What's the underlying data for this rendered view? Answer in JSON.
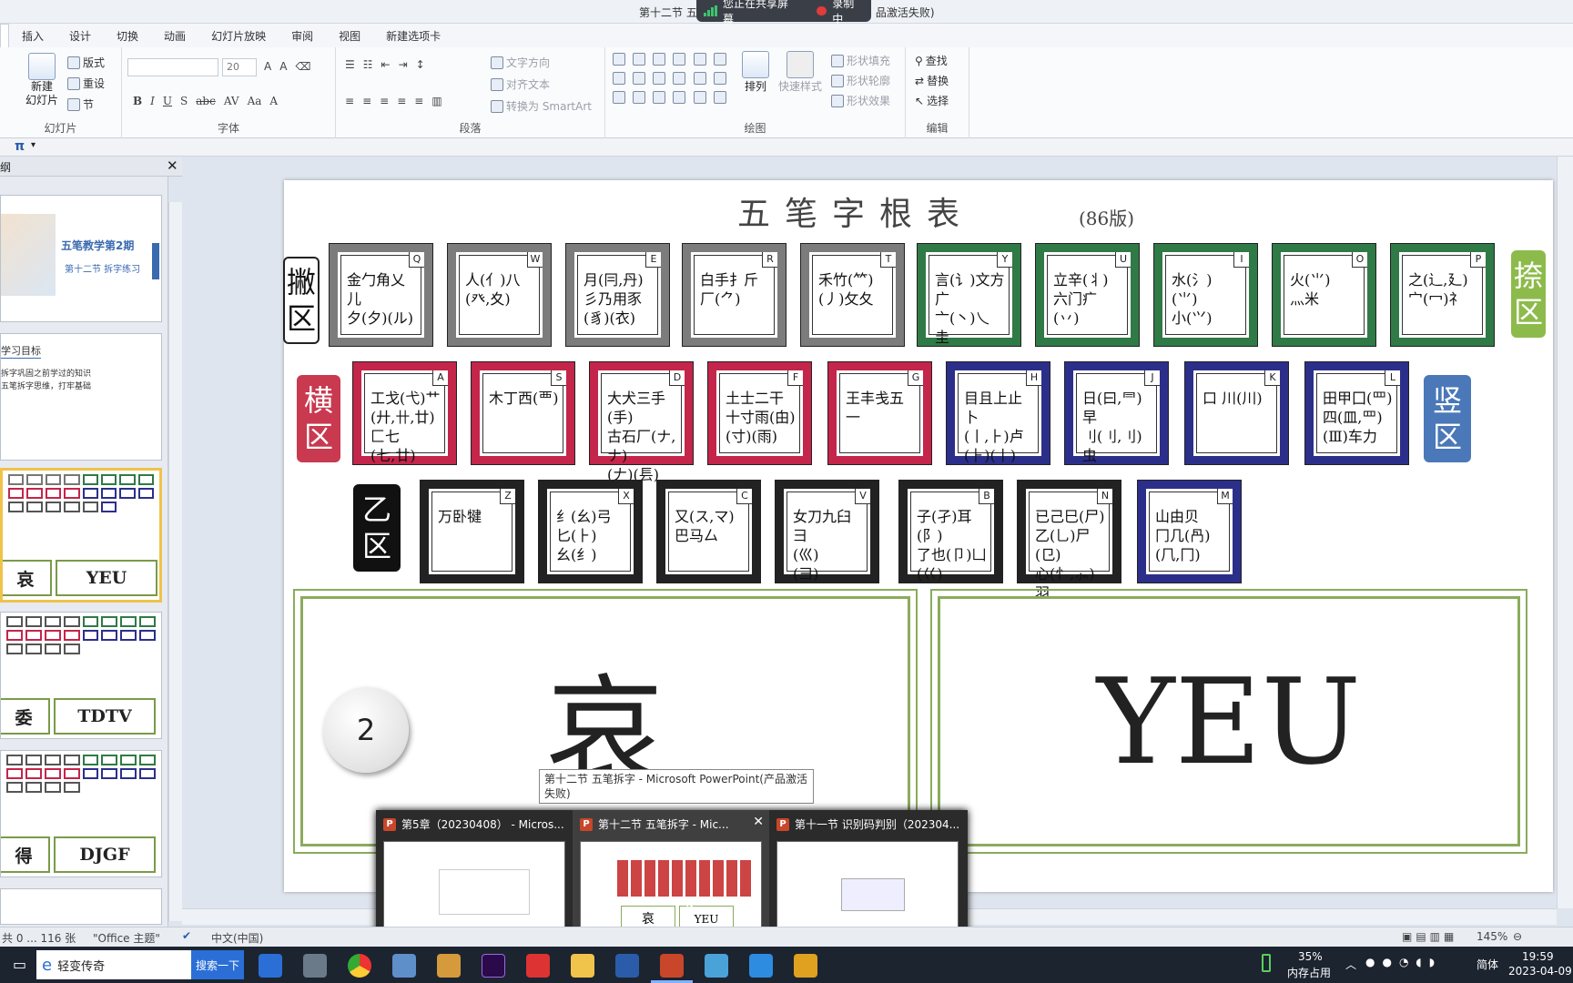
{
  "window": {
    "title_left": "第十二节 五",
    "title_right": "品激活失败)",
    "share_text": "您正在共享屏幕",
    "record_text": "录制中"
  },
  "tabs": [
    "插入",
    "设计",
    "切换",
    "动画",
    "幻灯片放映",
    "审阅",
    "视图",
    "新建选项卡"
  ],
  "ribbon": {
    "slides": {
      "new_slide": "新建\n幻灯片",
      "layout": "版式",
      "reset": "重设",
      "section": "节",
      "label": "幻灯片"
    },
    "font": {
      "size": "20",
      "label": "字体"
    },
    "paragraph": {
      "text_direction": "文字方向",
      "align_text": "对齐文本",
      "smartart": "转换为 SmartArt",
      "label": "段落"
    },
    "drawing": {
      "arrange": "排列",
      "quick_styles": "快速样式",
      "shape_fill": "形状填充",
      "shape_outline": "形状轮廓",
      "shape_effects": "形状效果",
      "label": "绘图"
    },
    "editing": {
      "find": "查找",
      "replace": "替换",
      "select": "选择",
      "label": "编辑"
    }
  },
  "qbar": {
    "pi": "π"
  },
  "panel": {
    "tab_label": "纲",
    "slide1": {
      "title": "五笔教学第2期",
      "subtitle": "第十二节 拆字练习"
    },
    "slide2": {
      "heading": "学习目标",
      "line1": "拆字巩固之前学过的知识",
      "line2": "五笔拆字思维，打牢基础"
    },
    "words": [
      {
        "han": "哀",
        "code": "YEU"
      },
      {
        "han": "委",
        "code": "TDTV"
      },
      {
        "han": "得",
        "code": "DJGF"
      }
    ]
  },
  "chart": {
    "title": "五笔字根表",
    "version": "(86版)",
    "zones": {
      "pie": "撇区",
      "na": "捺区",
      "heng": "横区",
      "shu": "竖区",
      "zhe": "乙区"
    },
    "colors": {
      "gray": "#7c7c7c",
      "green": "#2f7a46",
      "red": "#c4254a",
      "blue": "#2c2f8a",
      "black": "#222222",
      "zone_green": "#8dbb4b",
      "zone_red": "#c9394f",
      "zone_blue": "#4a78b8"
    },
    "row1": [
      {
        "key": "Q",
        "radicals": "金勹角乂儿\n夕(夕)(ル)"
      },
      {
        "key": "W",
        "radicals": "人(亻)八\n(癶,夊)"
      },
      {
        "key": "E",
        "radicals": "月(冃,丹)\n彡乃用豕\n(豸)(衣)"
      },
      {
        "key": "R",
        "radicals": "白手扌斤\n厂(⺈)"
      },
      {
        "key": "T",
        "radicals": "禾竹(⺮)\n(丿)攵夂"
      },
      {
        "key": "Y",
        "radicals": "言(讠)文方广\n亠(丶)乀\n圭"
      },
      {
        "key": "U",
        "radicals": "立辛(丬)\n六门疒\n(丷)"
      },
      {
        "key": "I",
        "radicals": "水(氵)\n(⺌)\n小(⺍)"
      },
      {
        "key": "O",
        "radicals": "火(⺌)\n灬米"
      },
      {
        "key": "P",
        "radicals": "之(辶,廴)\n宀(冖)礻"
      }
    ],
    "row2": [
      {
        "key": "A",
        "radicals": "工戈(弋)艹\n(廾,卄,廿)匚七\n(七,廿)"
      },
      {
        "key": "S",
        "radicals": "木丁西(覀)"
      },
      {
        "key": "D",
        "radicals": "大犬三手(手)\n古石厂(ナ,ナ)\n(𠂇)(镸)"
      },
      {
        "key": "F",
        "radicals": "土士二干\n十寸雨(甶)\n(寸)(雨)"
      },
      {
        "key": "G",
        "radicals": "王丰戋五\n一"
      },
      {
        "key": "H",
        "radicals": "目且上止卜\n(丨,⺊)卢\n(⺊)(丨)"
      },
      {
        "key": "J",
        "radicals": "日(曰,⺜)早\n刂(刂,刂)\n虫"
      },
      {
        "key": "K",
        "radicals": "口 川(川)"
      },
      {
        "key": "L",
        "radicals": "田甲囗(罒)\n四(皿,罒)\n(Ⅲ)车力"
      }
    ],
    "row3": [
      {
        "key": "Z",
        "radicals": "万卧犍"
      },
      {
        "key": "X",
        "radicals": "纟(幺)弓\n匕(⺊)\n幺(纟)"
      },
      {
        "key": "C",
        "radicals": "又(ス,マ)\n巴马厶"
      },
      {
        "key": "V",
        "radicals": "女刀九臼彐\n(巛)\n(彐)"
      },
      {
        "key": "B",
        "radicals": "子(孑)耳(阝)\n了也(卩)凵\n(巜)"
      },
      {
        "key": "N",
        "radicals": "已己巳(尸)\n乙(乚)尸(㔾)\n心(忄,⺗)羽"
      },
      {
        "key": "M",
        "radicals": "山由贝\n冂几(冎)\n(𠘨,冂)"
      }
    ]
  },
  "question": {
    "number": "2",
    "han": "哀",
    "code": "YEU"
  },
  "tooltip": "第十二节 五笔拆字 - Microsoft PowerPoint(产品激活失败)",
  "previews": [
    {
      "title": "第5章（20230408） - Micros..."
    },
    {
      "title": "第十二节 五笔拆字 - Mic...",
      "mini_han": "哀",
      "mini_code": "YEU"
    },
    {
      "title": "第十一节 识别码判别（202304..."
    }
  ],
  "status": {
    "slide_count": "共 0 ... 116 张",
    "theme": "\"Office 主题\"",
    "lang": "中文(中国)",
    "zoom": "145%"
  },
  "taskbar": {
    "search_text": "轻变传奇",
    "search_btn": "搜索一下",
    "mem_pct": "35%",
    "mem_label": "内存占用",
    "ime": "简体",
    "time": "19:59",
    "date": "2023-04-09"
  }
}
